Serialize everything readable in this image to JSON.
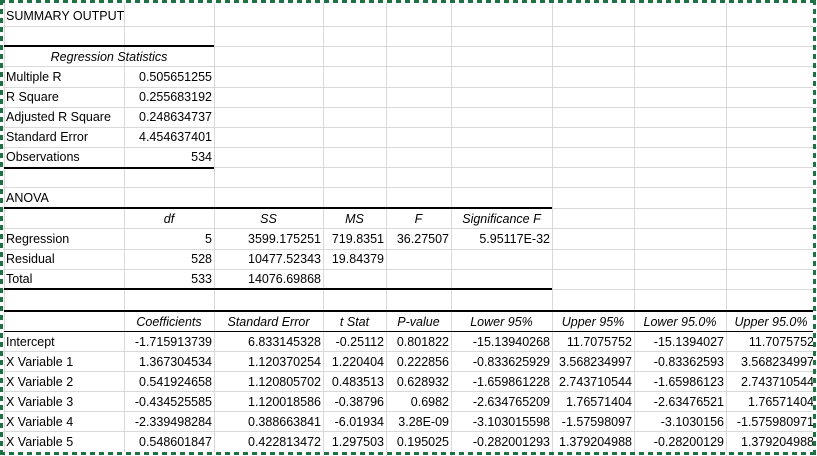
{
  "summary_title": "SUMMARY OUTPUT",
  "regression_statistics": {
    "header": "Regression Statistics",
    "rows": [
      {
        "label": "Multiple R",
        "value": "0.505651255"
      },
      {
        "label": "R Square",
        "value": "0.255683192"
      },
      {
        "label": "Adjusted R Square",
        "value": "0.248634737"
      },
      {
        "label": "Standard Error",
        "value": "4.454637401"
      },
      {
        "label": "Observations",
        "value": "534"
      }
    ]
  },
  "anova": {
    "title": "ANOVA",
    "headers": [
      "df",
      "SS",
      "MS",
      "F",
      "Significance F"
    ],
    "rows": [
      {
        "label": "Regression",
        "df": "5",
        "ss": "3599.175251",
        "ms": "719.8351",
        "f": "36.27507",
        "sigf": "5.95117E-32"
      },
      {
        "label": "Residual",
        "df": "528",
        "ss": "10477.52343",
        "ms": "19.84379",
        "f": "",
        "sigf": ""
      },
      {
        "label": "Total",
        "df": "533",
        "ss": "14076.69868",
        "ms": "",
        "f": "",
        "sigf": ""
      }
    ]
  },
  "coefficients": {
    "headers": [
      "Coefficients",
      "Standard Error",
      "t Stat",
      "P-value",
      "Lower 95%",
      "Upper 95%",
      "Lower 95.0%",
      "Upper 95.0%"
    ],
    "rows": [
      {
        "label": "Intercept",
        "vals": [
          "-1.715913739",
          "6.833145328",
          "-0.25112",
          "0.801822",
          "-15.13940268",
          "11.7075752",
          "-15.1394027",
          "11.7075752"
        ]
      },
      {
        "label": "X Variable 1",
        "vals": [
          "1.367304534",
          "1.120370254",
          "1.220404",
          "0.222856",
          "-0.833625929",
          "3.568234997",
          "-0.83362593",
          "3.568234997"
        ]
      },
      {
        "label": "X Variable 2",
        "vals": [
          "0.541924658",
          "1.120805702",
          "0.483513",
          "0.628932",
          "-1.659861228",
          "2.743710544",
          "-1.65986123",
          "2.743710544"
        ]
      },
      {
        "label": "X Variable 3",
        "vals": [
          "-0.434525585",
          "1.120018586",
          "-0.38796",
          "0.6982",
          "-2.634765209",
          "1.76571404",
          "-2.63476521",
          "1.76571404"
        ]
      },
      {
        "label": "X Variable 4",
        "vals": [
          "-2.339498284",
          "0.388663841",
          "-6.01934",
          "3.28E-09",
          "-3.103015598",
          "-1.57598097",
          "-3.1030156",
          "-1.575980971"
        ]
      },
      {
        "label": "X Variable 5",
        "vals": [
          "0.548601847",
          "0.422813472",
          "1.297503",
          "0.195025",
          "-0.282001293",
          "1.379204988",
          "-0.28200129",
          "1.379204988"
        ]
      }
    ]
  }
}
